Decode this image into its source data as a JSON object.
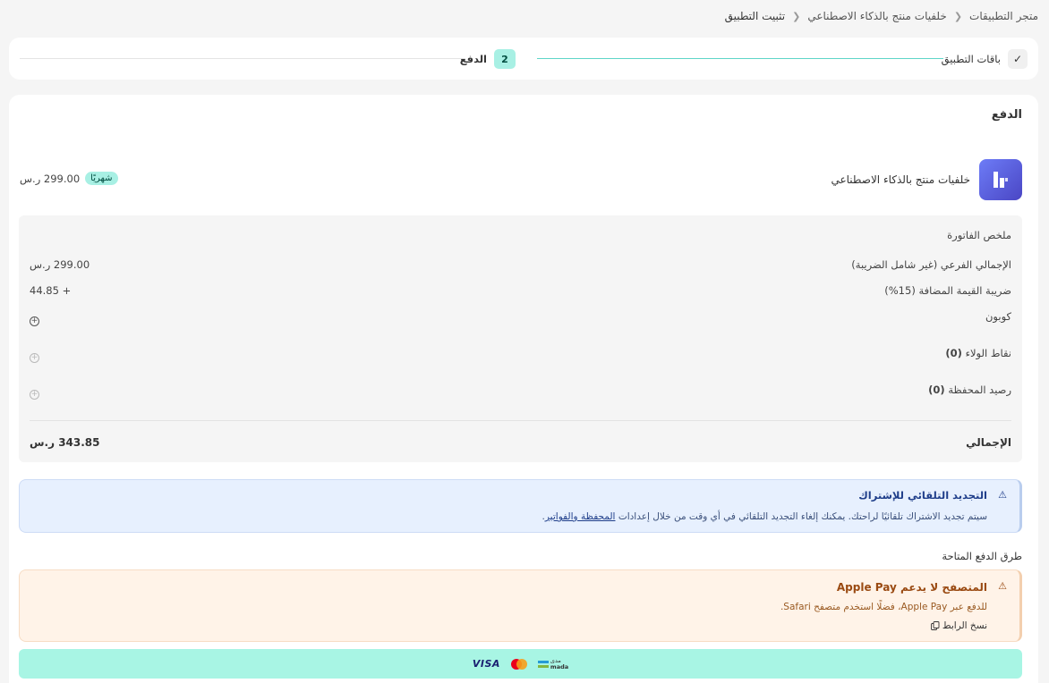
{
  "breadcrumb": {
    "items": [
      "متجر التطبيقات",
      "خلفيات منتج بالذكاء الاصطناعي"
    ],
    "current": "تثبيت التطبيق"
  },
  "stepper": {
    "step1_label": "باقات التطبيق",
    "step2_number": "2",
    "step2_label": "الدفع"
  },
  "payment": {
    "title": "الدفع",
    "product_name": "خلفيات منتج بالذكاء الاصطناعي",
    "badge": "شهريًا",
    "price": "299.00 ر.س"
  },
  "invoice": {
    "title": "ملخص الفاتورة",
    "rows": [
      {
        "label": "الإجمالي الفرعي (غير شامل الضريبة)",
        "value": "299.00 ر.س"
      },
      {
        "label": "ضريبة القيمة المضافة (15%)",
        "value": "+ 44.85"
      }
    ],
    "coupon_label": "كوبون",
    "loyalty_label": "نقاط الولاء",
    "loyalty_count": "(0)",
    "wallet_label": "رصيد المحفظة",
    "wallet_count": "(0)",
    "total_label": "الإجمالي",
    "total_value": "343.85 ر.س"
  },
  "auto_renew": {
    "title": "التجديد التلقائي للإشتراك",
    "text": "سيتم تجديد الاشتراك تلقائيًا لراحتك. يمكنك إلغاء التجديد التلقائي في أي وقت من خلال إعدادات",
    "link": "المحفظة والفواتير",
    "suffix": "."
  },
  "payment_methods": {
    "title": "طرق الدفع المتاحة",
    "alert_title": "المتصفح لا يدعم Apple Pay",
    "alert_text": "للدفع عبر Apple Pay، فضلًا استخدم متصفح Safari.",
    "copy_link": "نسخ الرابط",
    "card_brands": [
      "VISA",
      "mastercard",
      "mada"
    ],
    "mada_top": "مدى",
    "mada_bottom": "mada"
  },
  "colors": {
    "accent": "#a8f0e4",
    "accent_line": "#5fd6c8",
    "logo": "#5a5ee0",
    "info_bg": "#e7f0fe",
    "warn_bg": "#fff3e8"
  },
  "icons": {
    "check": "check-icon",
    "chevron": "chevron-left-icon",
    "warning": "warning-triangle-icon",
    "plus": "plus-circle-icon",
    "copy": "copy-icon"
  }
}
